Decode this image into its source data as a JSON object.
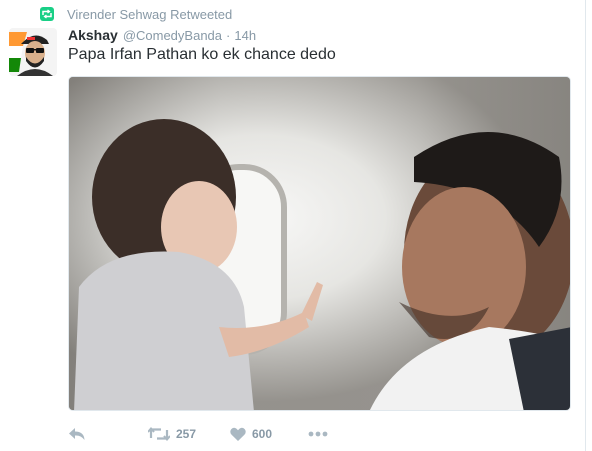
{
  "context": {
    "retweet_text": "Virender Sehwag Retweeted",
    "icon": "retweet-badge-icon",
    "badge_color": "#19cf86"
  },
  "tweet": {
    "name": "Akshay",
    "handle": "@ComedyBanda",
    "separator": "·",
    "time": "14h",
    "text": "Papa Irfan Pathan ko ek chance dedo",
    "avatar_icon": "avatar-icon",
    "photo_icon": "photo-icon"
  },
  "actions": {
    "reply_icon": "reply-icon",
    "retweet_icon": "retweet-icon",
    "retweet_count": "257",
    "like_icon": "heart-icon",
    "like_count": "600",
    "more_icon": "more-icon"
  },
  "colors": {
    "text": "#292f33",
    "muted": "#8899a6",
    "icon": "#aab8c2"
  }
}
